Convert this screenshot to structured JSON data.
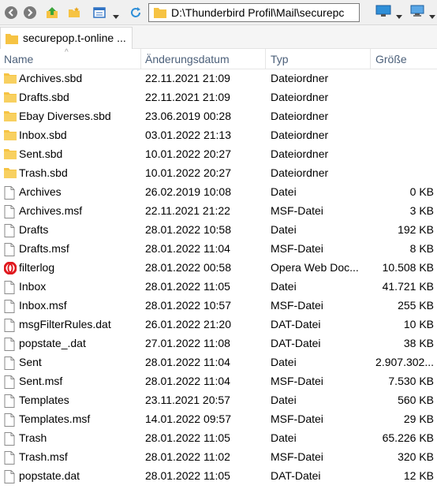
{
  "toolbar": {
    "address": "D:\\Thunderbird Profil\\Mail\\securepc",
    "icons": [
      "back-icon",
      "forward-icon",
      "up-folder-icon",
      "new-folder-icon",
      "view-icon",
      "refresh-icon",
      "folder-icon",
      "monitor-icon",
      "desktop-icon"
    ]
  },
  "tab": {
    "label": "securepop.t-online ..."
  },
  "columns": {
    "name": "Name",
    "date": "Änderungsdatum",
    "type": "Typ",
    "size": "Größe"
  },
  "colors": {
    "folder": "#f6c343",
    "header_text": "#4c607a",
    "opera": "#e0191f"
  },
  "files": [
    {
      "icon": "folder-icon",
      "name": "Archives.sbd",
      "date": "22.11.2021 21:09",
      "type": "Dateiordner",
      "size": ""
    },
    {
      "icon": "folder-icon",
      "name": "Drafts.sbd",
      "date": "22.11.2021 21:09",
      "type": "Dateiordner",
      "size": ""
    },
    {
      "icon": "folder-icon",
      "name": "Ebay Diverses.sbd",
      "date": "23.06.2019 00:28",
      "type": "Dateiordner",
      "size": ""
    },
    {
      "icon": "folder-icon",
      "name": "Inbox.sbd",
      "date": "03.01.2022 21:13",
      "type": "Dateiordner",
      "size": ""
    },
    {
      "icon": "folder-icon",
      "name": "Sent.sbd",
      "date": "10.01.2022 20:27",
      "type": "Dateiordner",
      "size": ""
    },
    {
      "icon": "folder-icon",
      "name": "Trash.sbd",
      "date": "10.01.2022 20:27",
      "type": "Dateiordner",
      "size": ""
    },
    {
      "icon": "file-icon",
      "name": "Archives",
      "date": "26.02.2019 10:08",
      "type": "Datei",
      "size": "0 KB"
    },
    {
      "icon": "file-icon",
      "name": "Archives.msf",
      "date": "22.11.2021 21:22",
      "type": "MSF-Datei",
      "size": "3 KB"
    },
    {
      "icon": "file-icon",
      "name": "Drafts",
      "date": "28.01.2022 10:58",
      "type": "Datei",
      "size": "192 KB"
    },
    {
      "icon": "file-icon",
      "name": "Drafts.msf",
      "date": "28.01.2022 11:04",
      "type": "MSF-Datei",
      "size": "8 KB"
    },
    {
      "icon": "opera-icon",
      "name": "filterlog",
      "date": "28.01.2022 00:58",
      "type": "Opera Web Doc...",
      "size": "10.508 KB"
    },
    {
      "icon": "file-icon",
      "name": "Inbox",
      "date": "28.01.2022 11:05",
      "type": "Datei",
      "size": "41.721 KB"
    },
    {
      "icon": "file-icon",
      "name": "Inbox.msf",
      "date": "28.01.2022 10:57",
      "type": "MSF-Datei",
      "size": "255 KB"
    },
    {
      "icon": "file-icon",
      "name": "msgFilterRules.dat",
      "date": "26.01.2022 21:20",
      "type": "DAT-Datei",
      "size": "10 KB"
    },
    {
      "icon": "file-icon",
      "name": "popstate_.dat",
      "date": "27.01.2022 11:08",
      "type": "DAT-Datei",
      "size": "38 KB"
    },
    {
      "icon": "file-icon",
      "name": "Sent",
      "date": "28.01.2022 11:04",
      "type": "Datei",
      "size": "2.907.302..."
    },
    {
      "icon": "file-icon",
      "name": "Sent.msf",
      "date": "28.01.2022 11:04",
      "type": "MSF-Datei",
      "size": "7.530 KB"
    },
    {
      "icon": "file-icon",
      "name": "Templates",
      "date": "23.11.2021 20:57",
      "type": "Datei",
      "size": "560 KB"
    },
    {
      "icon": "file-icon",
      "name": "Templates.msf",
      "date": "14.01.2022 09:57",
      "type": "MSF-Datei",
      "size": "29 KB"
    },
    {
      "icon": "file-icon",
      "name": "Trash",
      "date": "28.01.2022 11:05",
      "type": "Datei",
      "size": "65.226 KB"
    },
    {
      "icon": "file-icon",
      "name": "Trash.msf",
      "date": "28.01.2022 11:02",
      "type": "MSF-Datei",
      "size": "320 KB"
    },
    {
      "icon": "file-icon",
      "name": "popstate.dat",
      "date": "28.01.2022 11:05",
      "type": "DAT-Datei",
      "size": "12 KB"
    }
  ]
}
